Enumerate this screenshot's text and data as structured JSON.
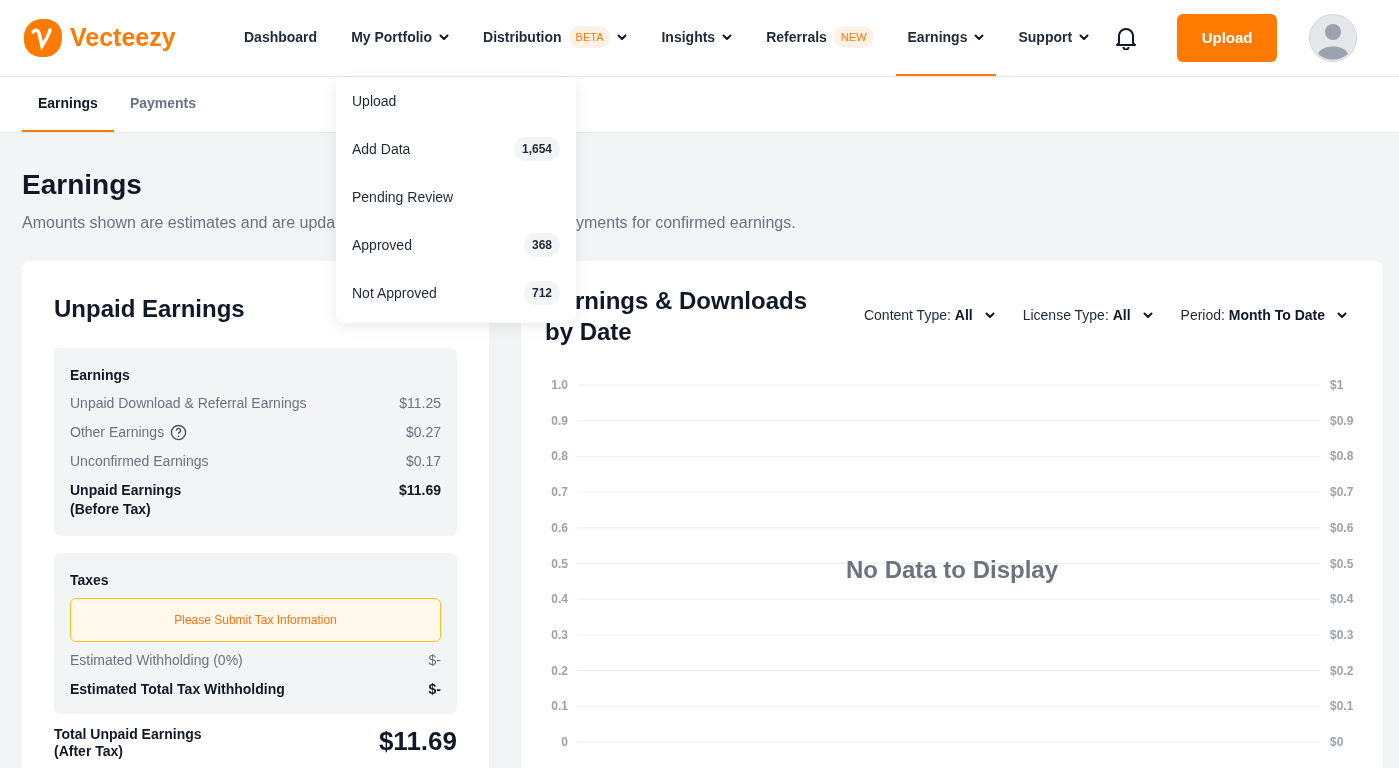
{
  "header": {
    "logo_text": "Vecteezy",
    "nav": [
      {
        "label": "Dashboard",
        "selected": false,
        "caret": false
      },
      {
        "label": "My Portfolio",
        "selected": false,
        "caret": true
      },
      {
        "label": "Distribution",
        "selected": false,
        "caret": true,
        "badge": "BETA"
      },
      {
        "label": "Insights",
        "selected": false,
        "caret": true
      },
      {
        "label": "Referrals",
        "selected": false,
        "caret": false,
        "badge": "NEW"
      },
      {
        "label": "Earnings",
        "selected": true,
        "caret": true
      },
      {
        "label": "Support",
        "selected": false,
        "caret": true
      }
    ],
    "upload_button": "Upload"
  },
  "portfolio_menu": [
    {
      "label": "Upload"
    },
    {
      "label": "Add Data",
      "count": "1,654"
    },
    {
      "label": "Pending Review"
    },
    {
      "label": "Approved",
      "count": "368"
    },
    {
      "label": "Not Approved",
      "count": "712"
    }
  ],
  "subtabs": [
    {
      "label": "Earnings",
      "selected": true
    },
    {
      "label": "Payments",
      "selected": false
    }
  ],
  "page_title": "Earnings",
  "subtitle_parts": [
    "Amounts shown are estimates and are upda",
    "yments for confirmed earnings."
  ],
  "unpaid": {
    "title": "Unpaid Earnings",
    "earnings": {
      "heading": "Earnings",
      "rows": [
        {
          "kind": "item",
          "label": "Unpaid Download & Referral Earnings",
          "value": "$11.25"
        },
        {
          "kind": "item",
          "label": "Other Earnings",
          "value": "$0.27",
          "info": true
        },
        {
          "kind": "item",
          "label": "Unconfirmed Earnings",
          "value": "$0.17"
        },
        {
          "kind": "total",
          "label": "Unpaid Earnings",
          "note": "(Before Tax)",
          "value": "$11.69"
        }
      ]
    },
    "taxes": {
      "heading": "Taxes",
      "notice": "Please Submit Tax Information",
      "rows": [
        {
          "kind": "item",
          "label": "Estimated Withholding (0%)",
          "value": "$-"
        },
        {
          "kind": "total",
          "label": "Estimated Total Tax Withholding",
          "value": "$-"
        }
      ]
    },
    "total": {
      "label": "Total Unpaid Earnings",
      "note": "(After Tax)",
      "value": "$11.69"
    }
  },
  "chart_panel": {
    "title_lines": [
      "rnings & Downloads",
      "by Date"
    ],
    "filters": [
      {
        "label": "Content Type:",
        "value": "All"
      },
      {
        "label": "License Type:",
        "value": "All"
      },
      {
        "label": "Period:",
        "value": "Month To Date"
      }
    ],
    "empty_message": "No Data to Display",
    "right_axis_labels": [
      "$1",
      "$0.9",
      "$0.8",
      "$0.7",
      "$0.6",
      "$0.5",
      "$0.4",
      "$0.3",
      "$0.2",
      "$0.1",
      "$0"
    ],
    "left_axis_labels": [
      "1.0",
      "0.9",
      "0.8",
      "0.7",
      "0.6",
      "0.5",
      "0.4",
      "0.3",
      "0.2",
      "0.1",
      "0"
    ]
  }
}
